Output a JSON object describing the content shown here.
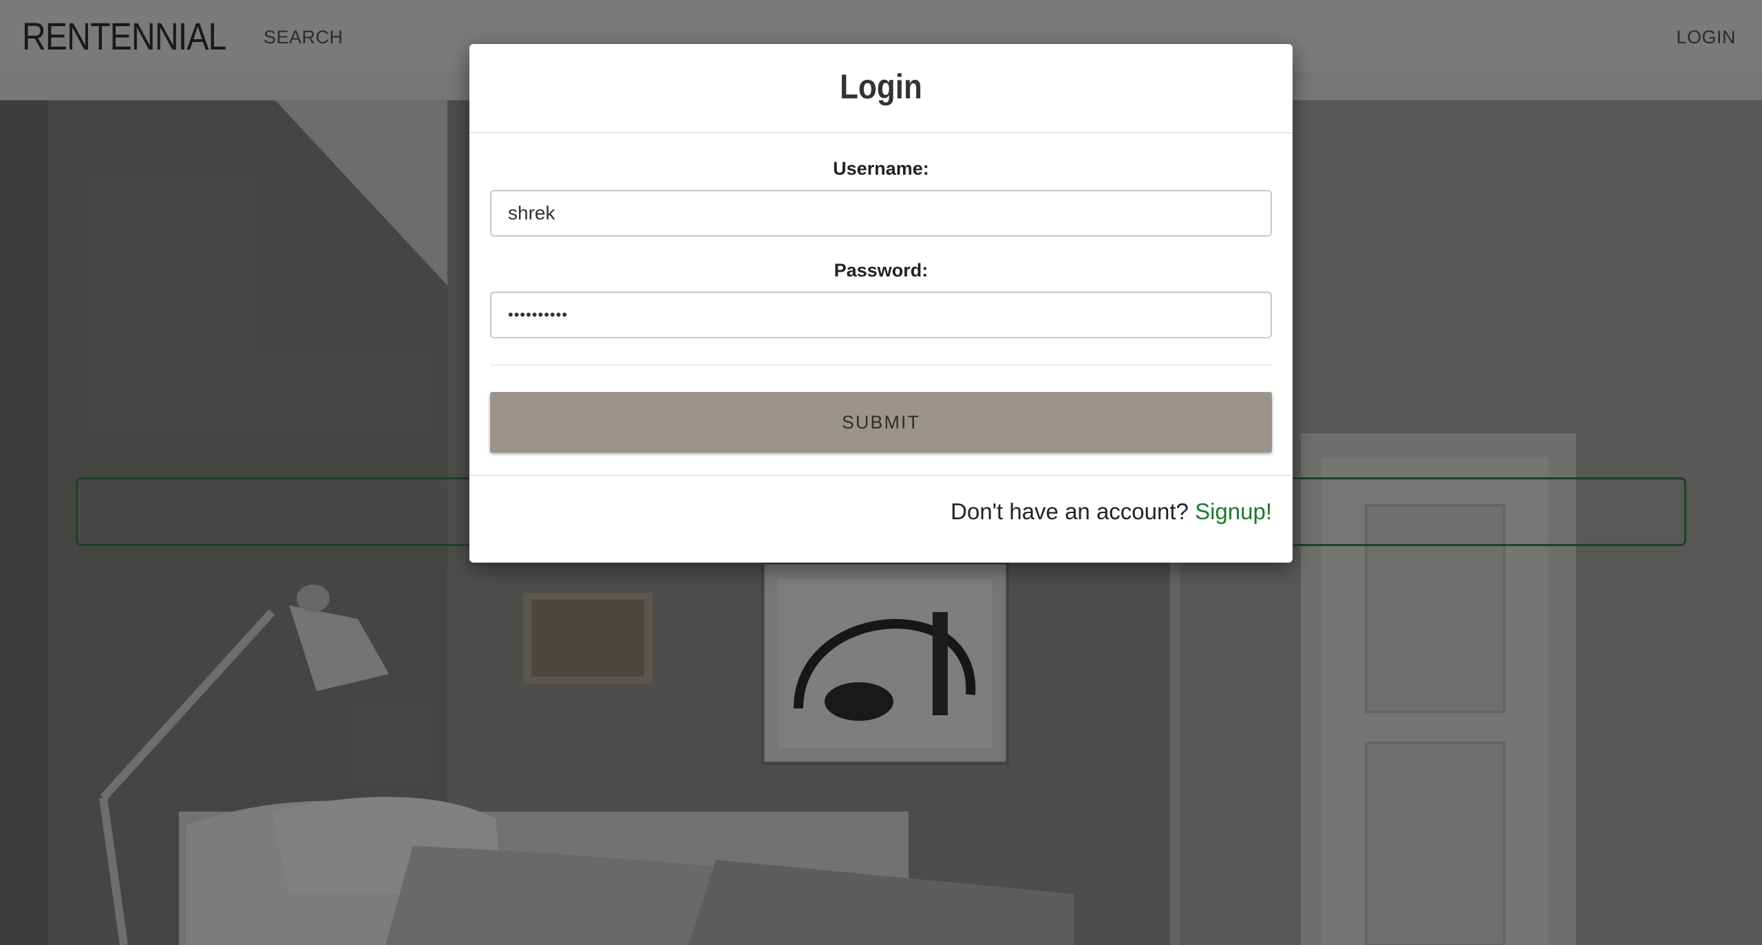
{
  "navbar": {
    "brand": "RENTENNIAL",
    "search_label": "SEARCH",
    "login_label": "LOGIN"
  },
  "modal": {
    "title": "Login",
    "username_label": "Username:",
    "username_value": "shrek",
    "password_label": "Password:",
    "password_value": "••••••••••",
    "submit_label": "SUBMIT",
    "footer_prompt": "Don't have an account?",
    "signup_label": "Signup!"
  },
  "colors": {
    "submit_bg": "#9b948b",
    "signup_link": "#1b7a2e",
    "search_strip_border": "#2e7a4e"
  }
}
